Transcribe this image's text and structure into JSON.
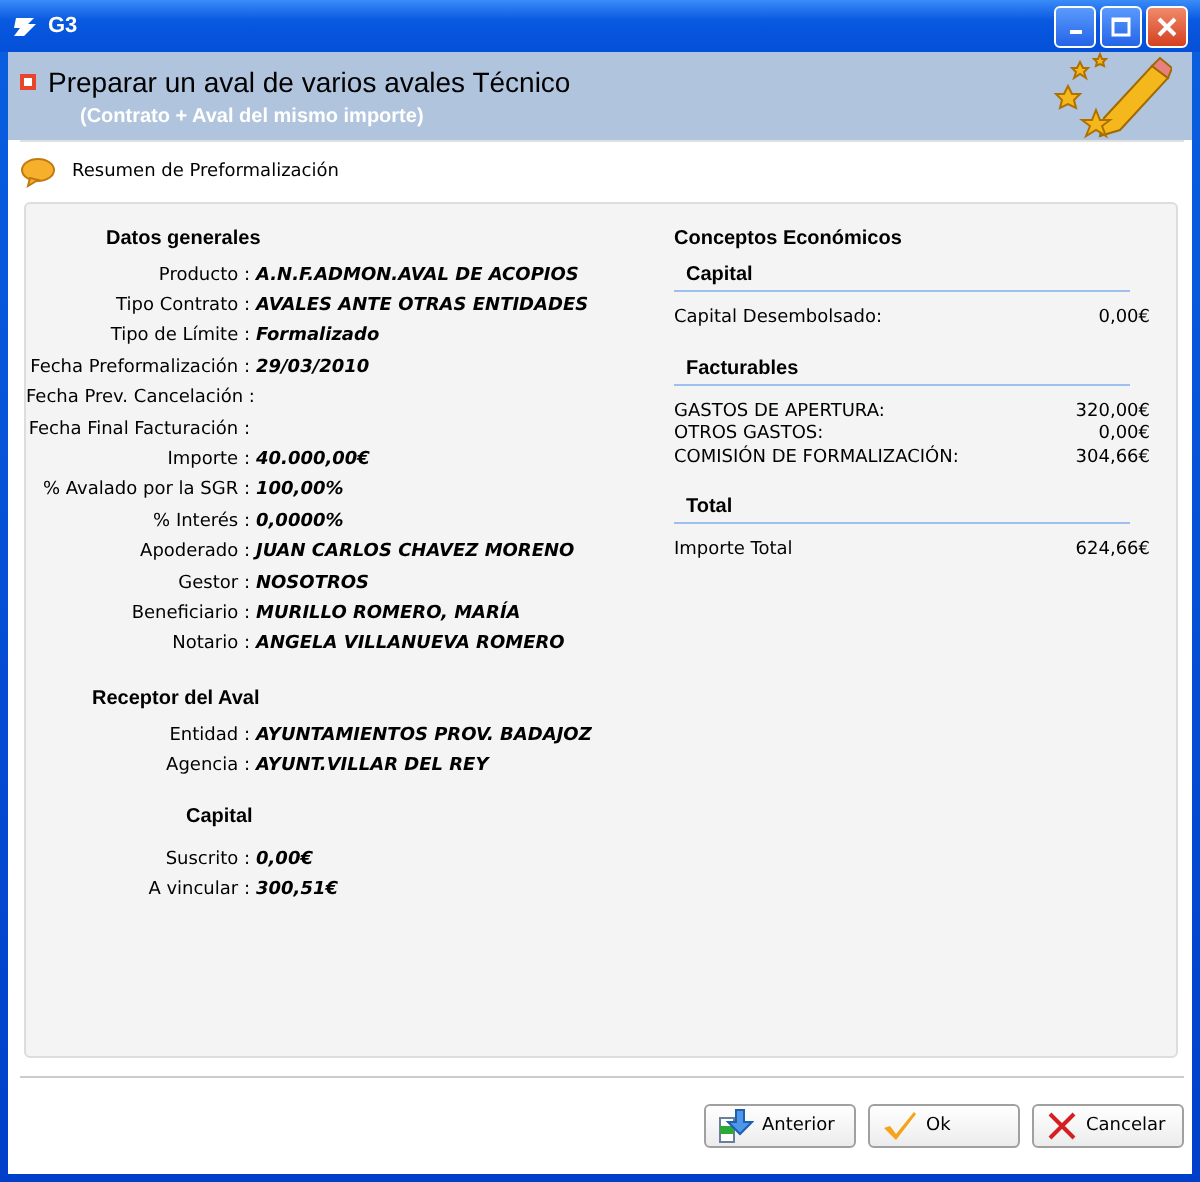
{
  "window": {
    "title": "G3"
  },
  "header": {
    "title": "Preparar un aval de varios avales Técnico",
    "subtitle": "(Contrato + Aval del mismo importe)"
  },
  "section_label": "Resumen de Preformalización",
  "general": [
    {
      "heading": "Datos generales",
      "fields": [
        {
          "label": "Producto :",
          "value": "A.N.F.ADMON.AVAL DE ACOPIOS"
        },
        {
          "label": "Tipo Contrato :",
          "value": "AVALES ANTE OTRAS ENTIDADES"
        },
        {
          "label": "Tipo de Límite :",
          "value": "Formalizado"
        },
        {
          "label": "Fecha Preformalización :",
          "value": "29/03/2010"
        },
        {
          "label": "Fecha Prev. Cancelación :"
        },
        {
          "label": "Fecha Final Facturación :"
        },
        {
          "label": "Importe :",
          "value": "40.000,00€"
        },
        {
          "label": "% Avalado por la SGR :",
          "value": "100,00%"
        },
        {
          "label": "% Interés :",
          "value": "0,0000%"
        },
        {
          "label": "Apoderado :",
          "value": "JUAN CARLOS CHAVEZ MORENO"
        },
        {
          "label": "Gestor :",
          "value": "NOSOTROS"
        },
        {
          "label": "Beneficiario :",
          "value": "MURILLO ROMERO, MARÍA"
        },
        {
          "label": "Notario :",
          "value": "ANGELA VILLANUEVA ROMERO"
        }
      ]
    },
    {
      "heading": "Receptor del Aval",
      "fields": [
        {
          "label": "Entidad :",
          "value": "AYUNTAMIENTOS PROV. BADAJOZ"
        },
        {
          "label": "Agencia :",
          "value": "AYUNT.VILLAR DEL REY"
        }
      ]
    },
    {
      "heading": "Capital",
      "fields": [
        {
          "label": "Suscrito :",
          "value": "0,00€"
        },
        {
          "label": "A vincular :",
          "value": "300,51€"
        }
      ]
    }
  ],
  "economics": {
    "title": "Conceptos Económicos",
    "groups": [
      {
        "heading": "Capital",
        "items": [
          {
            "label": "Capital Desembolsado:",
            "value": "0,00€"
          }
        ]
      },
      {
        "heading": "Facturables",
        "items": [
          {
            "label": "GASTOS DE APERTURA:",
            "value": "320,00€"
          },
          {
            "label": "OTROS GASTOS:",
            "value": "0,00€"
          },
          {
            "label": "COMISIÓN DE FORMALIZACIÓN:",
            "value": "304,66€"
          }
        ]
      },
      {
        "heading": "Total",
        "items": [
          {
            "label": "Importe Total",
            "value": "624,66€"
          }
        ]
      }
    ]
  },
  "buttons": [
    {
      "kind": "back",
      "label": "Anterior"
    },
    {
      "kind": "ok",
      "label": "Ok"
    },
    {
      "kind": "cancel",
      "label": "Cancelar"
    }
  ]
}
